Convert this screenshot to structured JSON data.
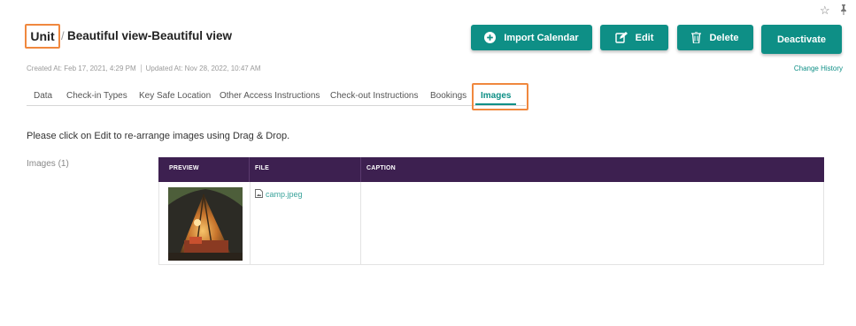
{
  "header": {
    "unit_label": "Unit",
    "separator": "/",
    "title": "Beautiful view-Beautiful view",
    "meta_created": "Created At: Feb 17, 2021, 4:29 PM",
    "meta_updated": "Updated At: Nov 28, 2022, 10:47 AM",
    "change_history": "Change History"
  },
  "toolbar": {
    "import_calendar": "Import Calendar",
    "edit": "Edit",
    "delete": "Delete",
    "deactivate": "Deactivate"
  },
  "tabs": [
    {
      "label": "Data"
    },
    {
      "label": "Check-in Types"
    },
    {
      "label": "Key Safe Location"
    },
    {
      "label": "Other Access Instructions"
    },
    {
      "label": "Check-out Instructions"
    },
    {
      "label": "Bookings"
    },
    {
      "label": "Images",
      "active": true
    }
  ],
  "main": {
    "instruction": "Please click on Edit to re-arrange images using Drag & Drop.",
    "images_label": "Images (1)",
    "table": {
      "columns": [
        "PREVIEW",
        "FILE",
        "CAPTION"
      ],
      "rows": [
        {
          "file": "camp.jpeg",
          "caption": ""
        }
      ]
    }
  },
  "colors": {
    "accent": "#0e8f86",
    "table_header": "#3d2050",
    "highlight": "#f0883e"
  },
  "icons": [
    "star-outline-icon",
    "pin-icon",
    "plus-circle-icon",
    "edit-icon",
    "trash-icon",
    "file-image-icon"
  ]
}
